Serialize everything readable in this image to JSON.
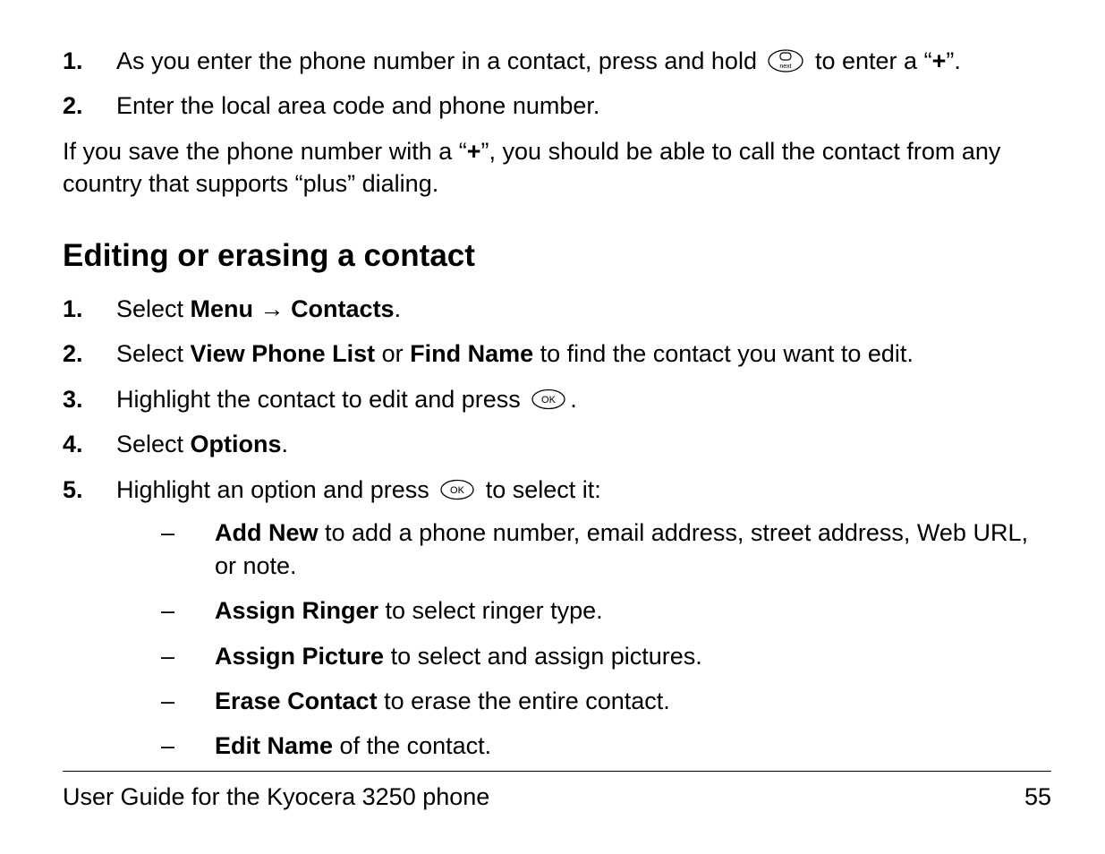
{
  "section1": {
    "items": [
      {
        "num": "1.",
        "pre": "As you enter the phone number in a contact, press and hold ",
        "icon": "zero-next",
        "post_a": " to enter a “",
        "bold": "+",
        "post_b": "”."
      },
      {
        "num": "2.",
        "text": "Enter the local area code and phone number."
      }
    ],
    "para_a": "If you save the phone number with a “",
    "para_bold": "+",
    "para_b": "”, you should be able to call the contact from any country that supports “plus” dialing."
  },
  "heading": "Editing or erasing a contact",
  "section2": {
    "items": [
      {
        "num": "1.",
        "a": "Select ",
        "b1": "Menu",
        "arrow": " → ",
        "b2": "Contacts",
        "c": "."
      },
      {
        "num": "2.",
        "a": "Select ",
        "b1": "View Phone List",
        "mid": " or ",
        "b2": "Find Name",
        "c": " to find the contact you want to edit."
      },
      {
        "num": "3.",
        "a": "Highlight the contact to edit and press ",
        "icon": "ok",
        "c": "."
      },
      {
        "num": "4.",
        "a": "Select ",
        "b1": "Options",
        "c": "."
      },
      {
        "num": "5.",
        "a": "Highlight an option and press ",
        "icon": "ok",
        "c": " to select it:"
      }
    ],
    "sub": [
      {
        "b": "Add New",
        "t": " to add a phone number, email address, street address, Web URL, or note."
      },
      {
        "b": "Assign Ringer",
        "t": " to select ringer type."
      },
      {
        "b": "Assign Picture",
        "t": " to select and assign pictures."
      },
      {
        "b": "Erase Contact",
        "t": " to erase the entire contact."
      },
      {
        "b": "Edit Name",
        "t": " of the contact."
      }
    ],
    "dash": "–"
  },
  "footer": {
    "left": "User Guide for the Kyocera 3250 phone",
    "right": "55"
  }
}
